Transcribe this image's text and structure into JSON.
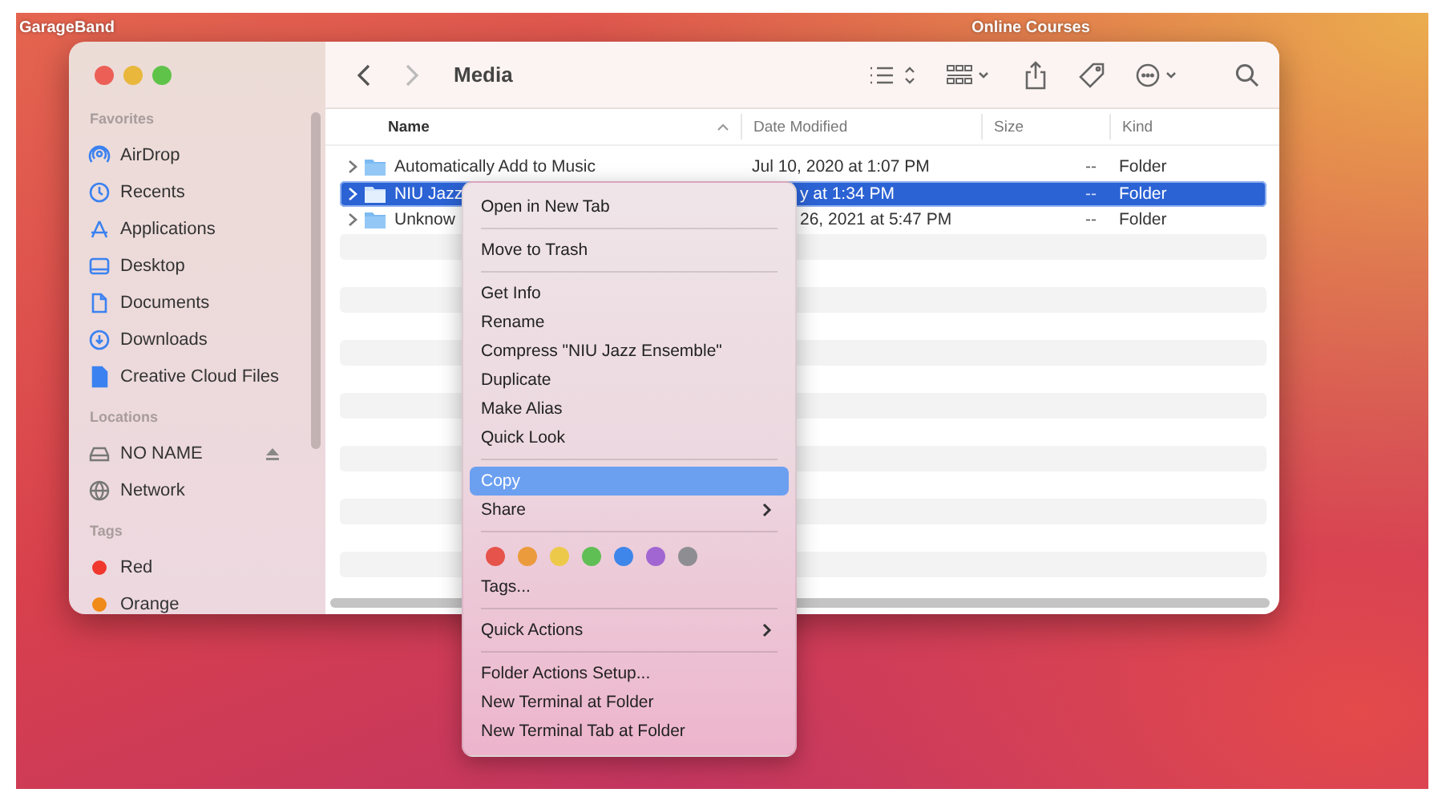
{
  "desktop": {
    "left_label": "GarageBand",
    "right_label": "Online Courses"
  },
  "finder": {
    "title": "Media",
    "nav": {
      "back_disabled": false,
      "forward_disabled": true
    },
    "sidebar": [
      {
        "heading": "Favorites",
        "items": [
          {
            "label": "AirDrop"
          },
          {
            "label": "Recents"
          },
          {
            "label": "Applications"
          },
          {
            "label": "Desktop"
          },
          {
            "label": "Documents"
          },
          {
            "label": "Downloads"
          },
          {
            "label": "Creative Cloud Files"
          }
        ]
      },
      {
        "heading": "Locations",
        "items": [
          {
            "label": "NO NAME",
            "ejectable": true
          },
          {
            "label": "Network",
            "ejectable": false
          }
        ]
      },
      {
        "heading": "Tags",
        "items": [
          {
            "label": "Red",
            "color": "#f0372e"
          },
          {
            "label": "Orange",
            "color": "#f08a18"
          }
        ]
      }
    ],
    "table": {
      "columns": [
        {
          "label": "Name",
          "sorted": true
        },
        {
          "label": "Date Modified",
          "sorted": false
        },
        {
          "label": "Size",
          "sorted": false
        },
        {
          "label": "Kind",
          "sorted": false
        }
      ],
      "rows": [
        {
          "name": "Automatically Add to Music",
          "date": "Jul 10, 2020 at 1:07 PM",
          "date_partly_hidden": false,
          "size": "--",
          "kind": "Folder",
          "selected": false
        },
        {
          "name": "NIU Jazz",
          "date": "y at 1:34 PM",
          "date_partly_hidden": true,
          "size": "--",
          "kind": "Folder",
          "selected": true
        },
        {
          "name": "Unknow",
          "date": "26, 2021 at 5:47 PM",
          "date_partly_hidden": true,
          "size": "--",
          "kind": "Folder",
          "selected": false
        }
      ]
    }
  },
  "context_menu": {
    "entries": [
      {
        "kind": "item",
        "label": "Open in New Tab",
        "selected": false,
        "submenu": false
      },
      {
        "kind": "separator"
      },
      {
        "kind": "item",
        "label": "Move to Trash",
        "selected": false,
        "submenu": false
      },
      {
        "kind": "separator"
      },
      {
        "kind": "item",
        "label": "Get Info",
        "selected": false,
        "submenu": false
      },
      {
        "kind": "item",
        "label": "Rename",
        "selected": false,
        "submenu": false
      },
      {
        "kind": "item",
        "label": "Compress \"NIU Jazz Ensemble\"",
        "selected": false,
        "submenu": false
      },
      {
        "kind": "item",
        "label": "Duplicate",
        "selected": false,
        "submenu": false
      },
      {
        "kind": "item",
        "label": "Make Alias",
        "selected": false,
        "submenu": false
      },
      {
        "kind": "item",
        "label": "Quick Look",
        "selected": false,
        "submenu": false
      },
      {
        "kind": "separator"
      },
      {
        "kind": "item",
        "label": "Copy",
        "selected": true,
        "submenu": false
      },
      {
        "kind": "item",
        "label": "Share",
        "selected": false,
        "submenu": true
      },
      {
        "kind": "separator"
      },
      {
        "kind": "tags",
        "colors": [
          {
            "color": "#e5534b"
          },
          {
            "color": "#eb9a3c"
          },
          {
            "color": "#edc94a"
          },
          {
            "color": "#5fbf55"
          },
          {
            "color": "#3f86ea"
          },
          {
            "color": "#a266d2"
          },
          {
            "color": "#8e8e92"
          }
        ]
      },
      {
        "kind": "item",
        "label": "Tags...",
        "selected": false,
        "submenu": false
      },
      {
        "kind": "separator"
      },
      {
        "kind": "item",
        "label": "Quick Actions",
        "selected": false,
        "submenu": true
      },
      {
        "kind": "separator"
      },
      {
        "kind": "item",
        "label": "Folder Actions Setup...",
        "selected": false,
        "submenu": false
      },
      {
        "kind": "item",
        "label": "New Terminal at Folder",
        "selected": false,
        "submenu": false
      },
      {
        "kind": "item",
        "label": "New Terminal Tab at Folder",
        "selected": false,
        "submenu": false
      }
    ]
  }
}
